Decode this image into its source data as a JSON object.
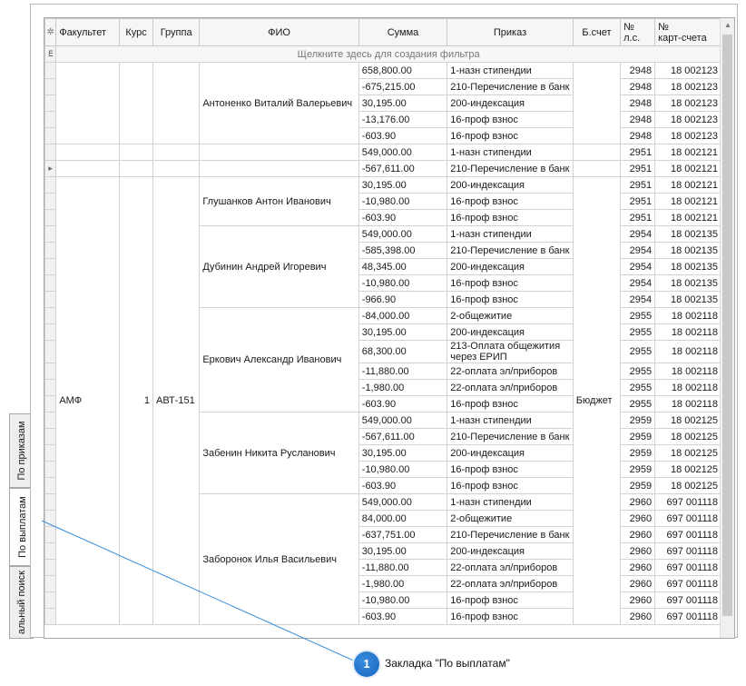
{
  "tabs": {
    "payments": "По выплатам",
    "orders": "По приказам",
    "general_search": "альный поиск"
  },
  "columns": {
    "faculty": "Факультет",
    "course": "Курс",
    "group": "Группа",
    "fio": "ФИО",
    "sum": "Сумма",
    "order": "Приказ",
    "account": "Б.счет",
    "personal_account_1": "№",
    "personal_account_2": "л.с.",
    "card_account_1": "№",
    "card_account_2": "карт-счета"
  },
  "filter_row": {
    "text": "Щелкните здесь для создания фильтра"
  },
  "group_values": {
    "faculty": "АМФ",
    "course": "1",
    "group": "АВТ-151",
    "account": "Бюджет"
  },
  "people": [
    "Антоненко Виталий Валерьевич",
    "Глушанков Антон Иванович",
    "Дубинин Андрей Игоревич",
    "Еркович Александр Иванович",
    "Забенин Никита Русланович",
    "Заборонок Илья Васильевич"
  ],
  "rows": [
    {
      "sum": "658,800.00",
      "order": "1-назн стипендии",
      "ls": "2948",
      "card": "18 002123"
    },
    {
      "sum": "-675,215.00",
      "order": "210-Перечисление в банк",
      "ls": "2948",
      "card": "18 002123"
    },
    {
      "sum": "30,195.00",
      "order": "200-индексация",
      "ls": "2948",
      "card": "18 002123"
    },
    {
      "sum": "-13,176.00",
      "order": "16-проф взнос",
      "ls": "2948",
      "card": "18 002123"
    },
    {
      "sum": "-603.90",
      "order": "16-проф взнос",
      "ls": "2948",
      "card": "18 002123"
    },
    {
      "sum": "549,000.00",
      "order": "1-назн стипендии",
      "ls": "2951",
      "card": "18 002121"
    },
    {
      "sum": "-567,611.00",
      "order": "210-Перечисление в банк",
      "ls": "2951",
      "card": "18 002121"
    },
    {
      "sum": "30,195.00",
      "order": "200-индексация",
      "ls": "2951",
      "card": "18 002121"
    },
    {
      "sum": "-10,980.00",
      "order": "16-проф взнос",
      "ls": "2951",
      "card": "18 002121"
    },
    {
      "sum": "-603.90",
      "order": "16-проф взнос",
      "ls": "2951",
      "card": "18 002121"
    },
    {
      "sum": "549,000.00",
      "order": "1-назн стипендии",
      "ls": "2954",
      "card": "18 002135"
    },
    {
      "sum": "-585,398.00",
      "order": "210-Перечисление в банк",
      "ls": "2954",
      "card": "18 002135"
    },
    {
      "sum": "48,345.00",
      "order": "200-индексация",
      "ls": "2954",
      "card": "18 002135"
    },
    {
      "sum": "-10,980.00",
      "order": "16-проф взнос",
      "ls": "2954",
      "card": "18 002135"
    },
    {
      "sum": "-966.90",
      "order": "16-проф взнос",
      "ls": "2954",
      "card": "18 002135"
    },
    {
      "sum": "-84,000.00",
      "order": "2-общежитие",
      "ls": "2955",
      "card": "18 002118"
    },
    {
      "sum": "30,195.00",
      "order": "200-индексация",
      "ls": "2955",
      "card": "18 002118"
    },
    {
      "sum": "68,300.00",
      "order": "213-Оплата общежития через ЕРИП",
      "order_line1": "213-Оплата общежития",
      "order_line2": "через ЕРИП",
      "ls": "2955",
      "card": "18 002118"
    },
    {
      "sum": "-11,880.00",
      "order": "22-оплата эл/приборов",
      "ls": "2955",
      "card": "18 002118"
    },
    {
      "sum": "-1,980.00",
      "order": "22-оплата эл/приборов",
      "ls": "2955",
      "card": "18 002118"
    },
    {
      "sum": "-603.90",
      "order": "16-проф взнос",
      "ls": "2955",
      "card": "18 002118"
    },
    {
      "sum": "549,000.00",
      "order": "1-назн стипендии",
      "ls": "2959",
      "card": "18 002125"
    },
    {
      "sum": "-567,611.00",
      "order": "210-Перечисление в банк",
      "ls": "2959",
      "card": "18 002125"
    },
    {
      "sum": "30,195.00",
      "order": "200-индексация",
      "ls": "2959",
      "card": "18 002125"
    },
    {
      "sum": "-10,980.00",
      "order": "16-проф взнос",
      "ls": "2959",
      "card": "18 002125"
    },
    {
      "sum": "-603.90",
      "order": "16-проф взнос",
      "ls": "2959",
      "card": "18 002125"
    },
    {
      "sum": "549,000.00",
      "order": "1-назн стипендии",
      "ls": "2960",
      "card": "697 001118"
    },
    {
      "sum": "84,000.00",
      "order": "2-общежитие",
      "ls": "2960",
      "card": "697 001118"
    },
    {
      "sum": "-637,751.00",
      "order": "210-Перечисление в банк",
      "ls": "2960",
      "card": "697 001118"
    },
    {
      "sum": "30,195.00",
      "order": "200-индексация",
      "ls": "2960",
      "card": "697 001118"
    },
    {
      "sum": "-11,880.00",
      "order": "22-оплата эл/приборов",
      "ls": "2960",
      "card": "697 001118"
    },
    {
      "sum": "-1,980.00",
      "order": "22-оплата эл/приборов",
      "ls": "2960",
      "card": "697 001118"
    },
    {
      "sum": "-10,980.00",
      "order": "16-проф взнос",
      "ls": "2960",
      "card": "697 001118"
    },
    {
      "sum": "-603.90",
      "order": "16-проф взнос",
      "ls": "2960",
      "card": "697 001118"
    }
  ],
  "callout": {
    "number": "1",
    "text": "Закладка \"По выплатам\""
  },
  "colors": {
    "callout_badge": "#1565c0",
    "callout_line": "#3a8ddd"
  }
}
